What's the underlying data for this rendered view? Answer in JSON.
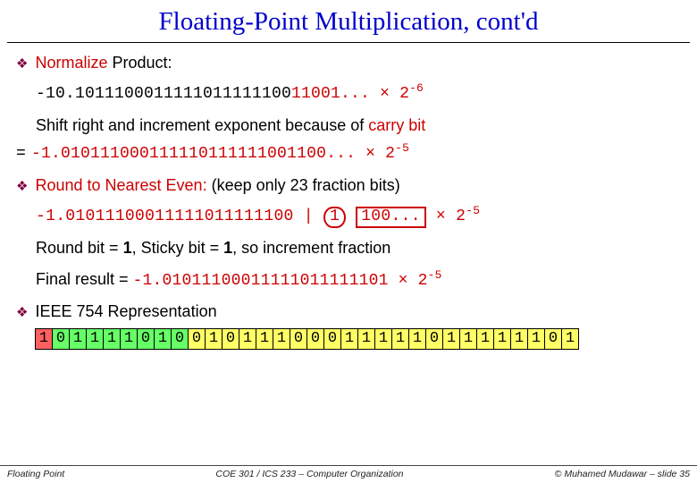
{
  "title": "Floating-Point Multiplication, cont'd",
  "sec1": {
    "head_a": "Normalize ",
    "head_b": "Product:",
    "expr1_a": "-10.1011100011111011111100",
    "expr1_b": "11001... × 2",
    "expr1_exp": "-6",
    "shift_a": "Shift right and increment exponent because of ",
    "shift_b": "carry bit",
    "expr2_eq": "=",
    "expr2_a": "-1.010111000111110111111001100... × 2",
    "expr2_exp": "-5"
  },
  "sec2": {
    "head_a": "Round to Nearest Even:",
    "head_b": " (keep only 23 fraction bits)",
    "expr_a": "-1.01011100011111011111100 |",
    "round_bit": "1",
    "tail_bits": "100...",
    "times": " × 2",
    "exp": "-5",
    "line_round_a": "Round bit = ",
    "line_round_b": "1",
    "line_round_c": ", Sticky bit = ",
    "line_round_d": "1",
    "line_round_e": ", so increment fraction",
    "final_a": "Final result = ",
    "final_b": "-1.01011100011111011111101 × 2",
    "final_exp": "-5"
  },
  "sec3": {
    "head": "IEEE 754 Representation",
    "sign": [
      "1"
    ],
    "exponent": [
      "0",
      "1",
      "1",
      "1",
      "1",
      "0",
      "1",
      "0"
    ],
    "fraction": [
      "0",
      "1",
      "0",
      "1",
      "1",
      "1",
      "0",
      "0",
      "0",
      "1",
      "1",
      "1",
      "1",
      "1",
      "0",
      "1",
      "1",
      "1",
      "1",
      "1",
      "1",
      "0",
      "1"
    ]
  },
  "footer": {
    "left": "Floating Point",
    "mid": "COE 301 / ICS 233 – Computer Organization",
    "right": "© Muhamed Mudawar – slide 35"
  }
}
